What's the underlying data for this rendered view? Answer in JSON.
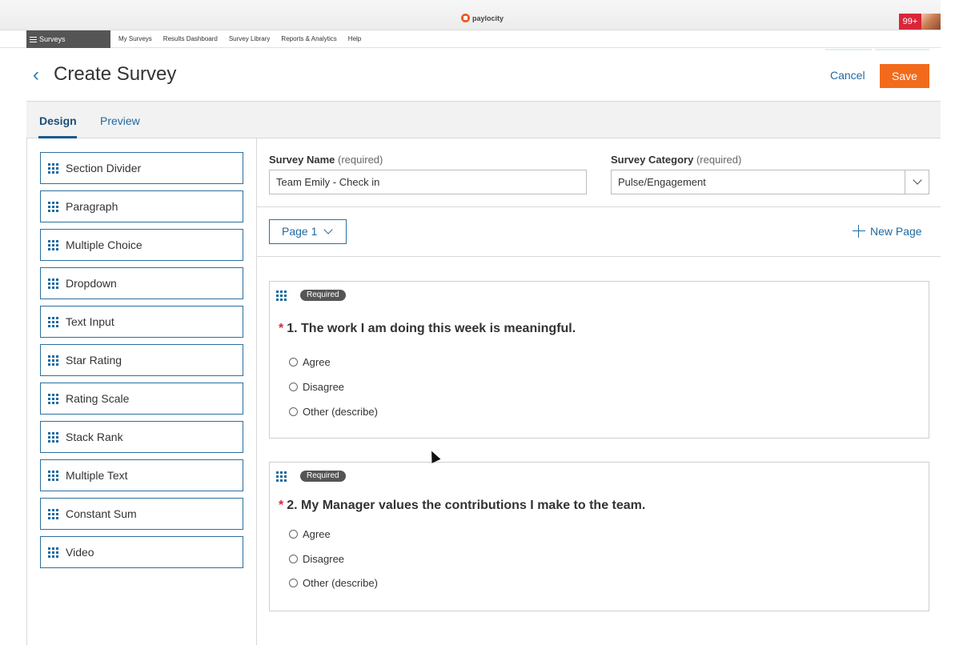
{
  "brand": {
    "name": "paylocity"
  },
  "notifications": {
    "count": "99+"
  },
  "nav": {
    "menu_label": "Surveys",
    "links": [
      "My Surveys",
      "Results Dashboard",
      "Survey Library",
      "Reports & Analytics",
      "Help"
    ]
  },
  "header": {
    "title": "Create Survey",
    "cancel_label": "Cancel",
    "save_label": "Save"
  },
  "tabs": [
    {
      "label": "Design",
      "active": true
    },
    {
      "label": "Preview",
      "active": false
    }
  ],
  "toolbox": [
    "Section Divider",
    "Paragraph",
    "Multiple Choice",
    "Dropdown",
    "Text Input",
    "Star Rating",
    "Rating Scale",
    "Stack Rank",
    "Multiple Text",
    "Constant Sum",
    "Video"
  ],
  "form": {
    "survey_name_label": "Survey Name",
    "survey_name_req": "(required)",
    "survey_name_value": "Team Emily - Check in",
    "category_label": "Survey Category",
    "category_req": "(required)",
    "category_value": "Pulse/Engagement"
  },
  "page_selector": "Page 1",
  "new_page_label": "New Page",
  "questions": [
    {
      "badge": "Required",
      "text": "1. The work I am doing this week is meaningful.",
      "options": [
        "Agree",
        "Disagree",
        "Other (describe)"
      ]
    },
    {
      "badge": "Required",
      "text": "2. My Manager values the contributions I make to the team.",
      "options": [
        "Agree",
        "Disagree",
        "Other (describe)"
      ]
    }
  ],
  "colors": {
    "accent": "#1f6aa0",
    "save": "#f26a1b",
    "required_star": "#d9263a"
  }
}
